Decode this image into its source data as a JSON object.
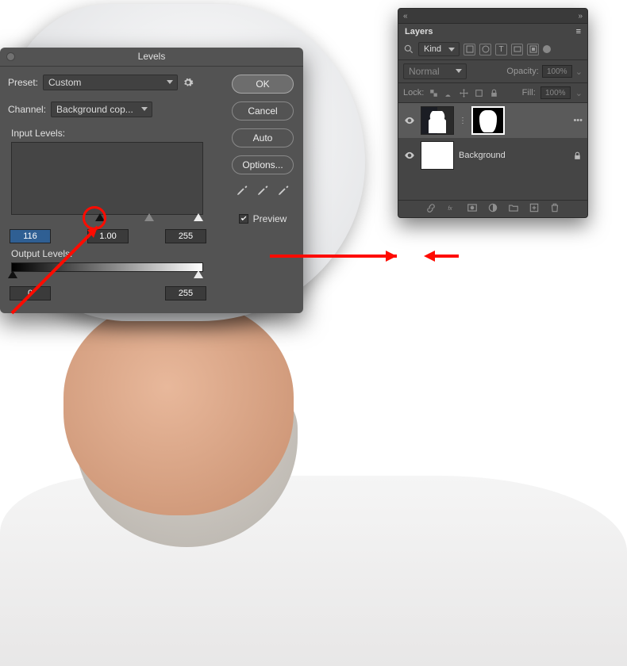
{
  "levels": {
    "title": "Levels",
    "preset_label": "Preset:",
    "preset_value": "Custom",
    "channel_label": "Channel:",
    "channel_value": "Background cop...",
    "input_label": "Input Levels:",
    "input_black": "116",
    "input_mid": "1.00",
    "input_white": "255",
    "output_label": "Output Levels:",
    "output_black": "0",
    "output_white": "255",
    "ok": "OK",
    "cancel": "Cancel",
    "auto": "Auto",
    "options": "Options...",
    "preview": "Preview"
  },
  "layers_panel": {
    "title": "Layers",
    "filter_kind": "Kind",
    "blend_mode": "Normal",
    "opacity_label": "Opacity:",
    "opacity_value": "100%",
    "lock_label": "Lock:",
    "fill_label": "Fill:",
    "fill_value": "100%",
    "layers": [
      {
        "name": "",
        "mask": true
      },
      {
        "name": "Background",
        "locked": true
      }
    ]
  }
}
